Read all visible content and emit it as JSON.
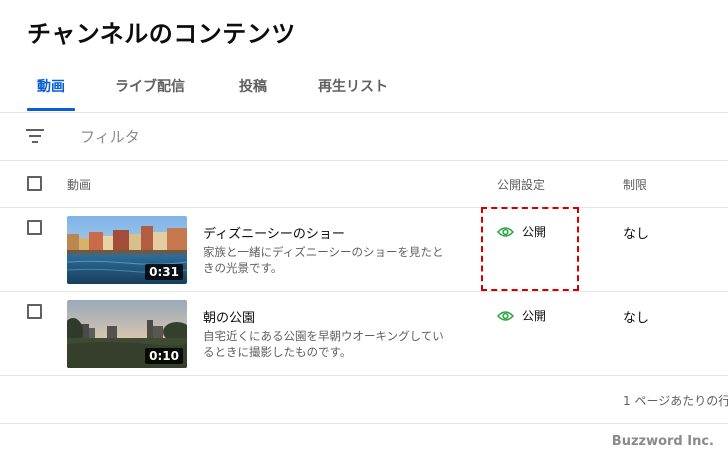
{
  "page_title": "チャンネルのコンテンツ",
  "tabs": [
    {
      "label": "動画",
      "active": true
    },
    {
      "label": "ライブ配信",
      "active": false
    },
    {
      "label": "投稿",
      "active": false
    },
    {
      "label": "再生リスト",
      "active": false
    }
  ],
  "filter": {
    "placeholder": "フィルタ",
    "icon": "filter-icon"
  },
  "table": {
    "headers": {
      "video": "動画",
      "visibility": "公開設定",
      "restrictions": "制限"
    },
    "rows": [
      {
        "title": "ディズニーシーのショー",
        "description": "家族と一緒にディズニーシーのショーを見たときの光景です。",
        "duration": "0:31",
        "visibility": "公開",
        "visibility_icon": "eye-icon",
        "restriction": "なし"
      },
      {
        "title": "朝の公園",
        "description": "自宅近くにある公園を早朝ウオーキングしているときに撮影したものです。",
        "duration": "0:10",
        "visibility": "公開",
        "visibility_icon": "eye-icon",
        "restriction": "なし"
      }
    ]
  },
  "pagination": {
    "rows_per_page_label": "1 ページあたりの行"
  },
  "watermark": "Buzzword Inc.",
  "colors": {
    "accent": "#065fd4",
    "public": "#2ba640",
    "highlight": "#d00000"
  }
}
